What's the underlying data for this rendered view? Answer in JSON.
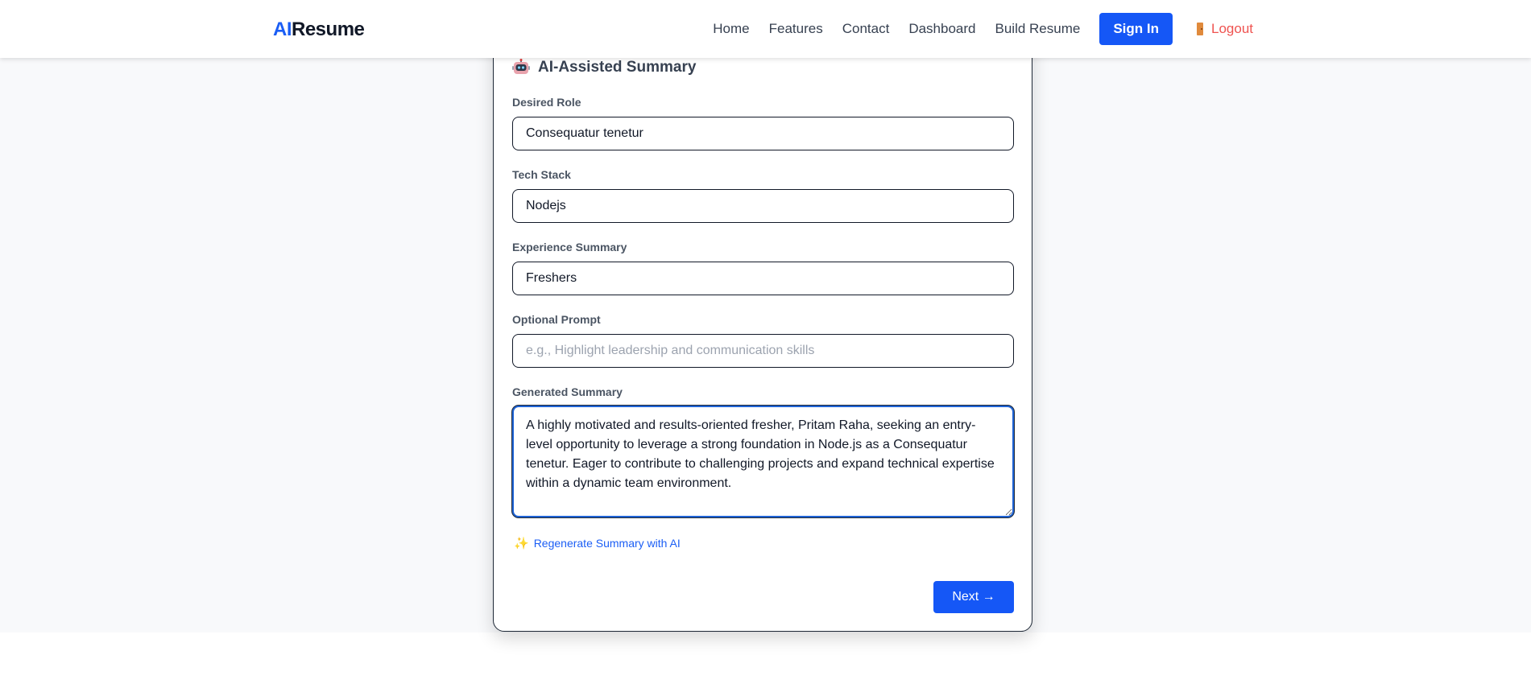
{
  "brand": {
    "prefix": "AI",
    "suffix": "Resume",
    "accent_color": "#1b5ef5"
  },
  "nav": {
    "links": [
      "Home",
      "Features",
      "Contact",
      "Dashboard",
      "Build Resume"
    ],
    "signin_label": "Sign In",
    "logout_label": "Logout",
    "logout_icon": "door-icon",
    "logout_color": "#ef5350"
  },
  "summary_section": {
    "title": "AI-Assisted Summary",
    "title_icon": "robot-icon",
    "fields": {
      "desired_role": {
        "label": "Desired Role",
        "value": "Consequatur tenetur"
      },
      "tech_stack": {
        "label": "Tech Stack",
        "value": "Nodejs"
      },
      "experience_summary": {
        "label": "Experience Summary",
        "value": "Freshers"
      },
      "optional_prompt": {
        "label": "Optional Prompt",
        "value": "",
        "placeholder": "e.g., Highlight leadership and communication skills"
      },
      "generated_summary": {
        "label": "Generated Summary",
        "value": "A highly motivated and results-oriented fresher, Pritam Raha, seeking an entry-level opportunity to leverage a strong foundation in Node.js as a Consequatur tenetur. Eager to contribute to challenging projects and expand technical expertise within a dynamic team environment."
      }
    },
    "regenerate_label": "Regenerate Summary with AI",
    "regenerate_icon": "sparkle-icon",
    "next_label": "Next →"
  },
  "colors": {
    "primary_button": "#1557f6",
    "page_background": "#f8f9fb"
  }
}
